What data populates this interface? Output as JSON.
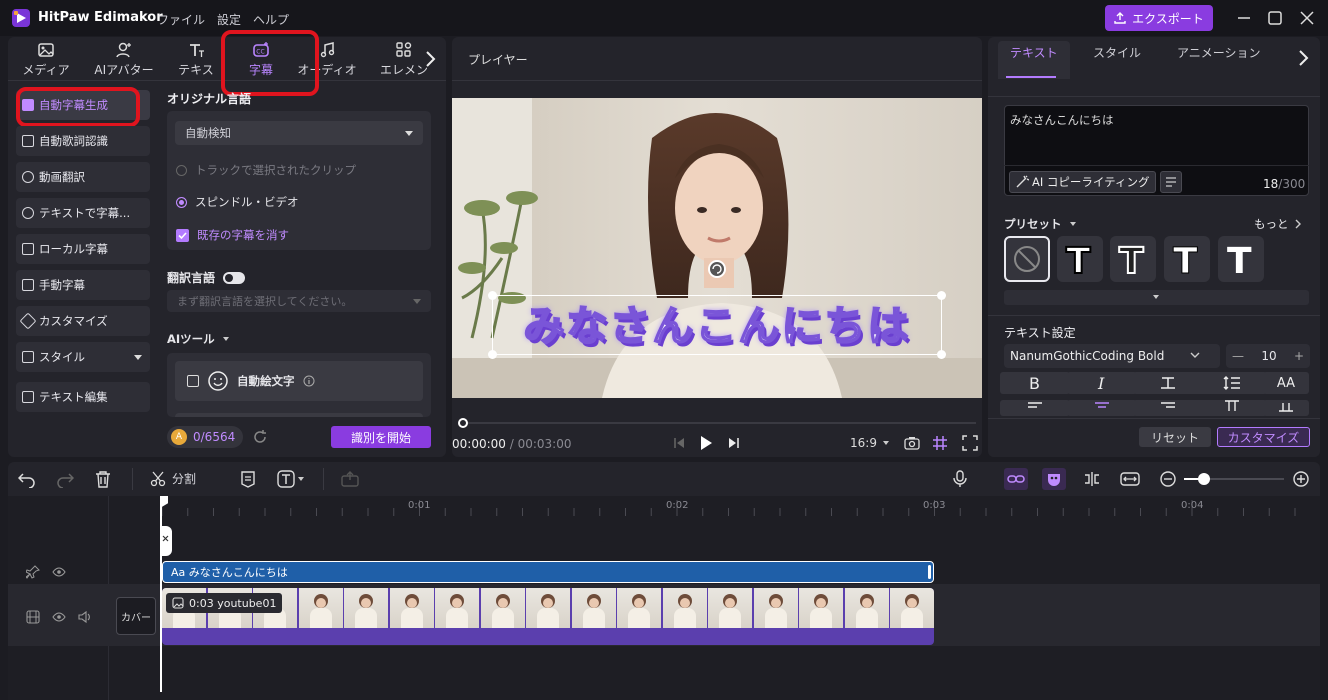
{
  "app": {
    "title": "HitPaw Edimakor",
    "accent": "#8a3ce0"
  },
  "menu": {
    "file": "ファイル",
    "settings": "設定",
    "help": "ヘルプ"
  },
  "export_label": "エクスポート",
  "categories": [
    {
      "label": "メディア"
    },
    {
      "label": "AIアバター"
    },
    {
      "label": "テキス"
    },
    {
      "label": "字幕"
    },
    {
      "label": "オーディオ"
    },
    {
      "label": "エレメン"
    }
  ],
  "subnav": [
    {
      "label": "自動字幕生成"
    },
    {
      "label": "自動歌詞認識"
    },
    {
      "label": "動画翻訳"
    },
    {
      "label": "テキストで字幕..."
    },
    {
      "label": "ローカル字幕"
    },
    {
      "label": "手動字幕"
    },
    {
      "label": "カスタマイズ"
    },
    {
      "label": "スタイル"
    },
    {
      "label": "テキスト編集"
    }
  ],
  "autosub": {
    "original_language_title": "オリジナル言語",
    "language_value": "自動検知",
    "option_track": "トラックで選択されたクリップ",
    "option_video": "スピンドル・ビデオ",
    "clear_existing": "既存の字幕を消す",
    "translate_title": "翻訳言語",
    "translate_placeholder": "まず翻訳言語を選択してください。",
    "ai_tools_title": "AIツール",
    "auto_emoji": "自動絵文字",
    "credits": "0/6564",
    "start_label": "識別を開始"
  },
  "player": {
    "title": "プレイヤー",
    "subtitle_text": "みなさんこんにちは",
    "current_time": "00:00:00",
    "total_time": "/ 00:03:00",
    "aspect": "16:9"
  },
  "text_panel": {
    "tabs": [
      "テキスト",
      "スタイル",
      "アニメーション"
    ],
    "content": "みなさんこんにちは",
    "ai_copy": "AI コピーライティング",
    "count": "18",
    "max": "/300",
    "preset_label": "プリセット",
    "more": "もっと",
    "settings_title": "テキスト設定",
    "font": "NanumGothicCoding Bold",
    "font_size": "10",
    "reset": "リセット",
    "customize": "カスタマイズ"
  },
  "timeline": {
    "split": "分割",
    "ruler": [
      "0:01",
      "0:02",
      "0:03",
      "0:04"
    ],
    "text_clip": "Aa みなさんこんにちは",
    "video_clip": "0:03 youtube01",
    "cover": "カバー"
  }
}
